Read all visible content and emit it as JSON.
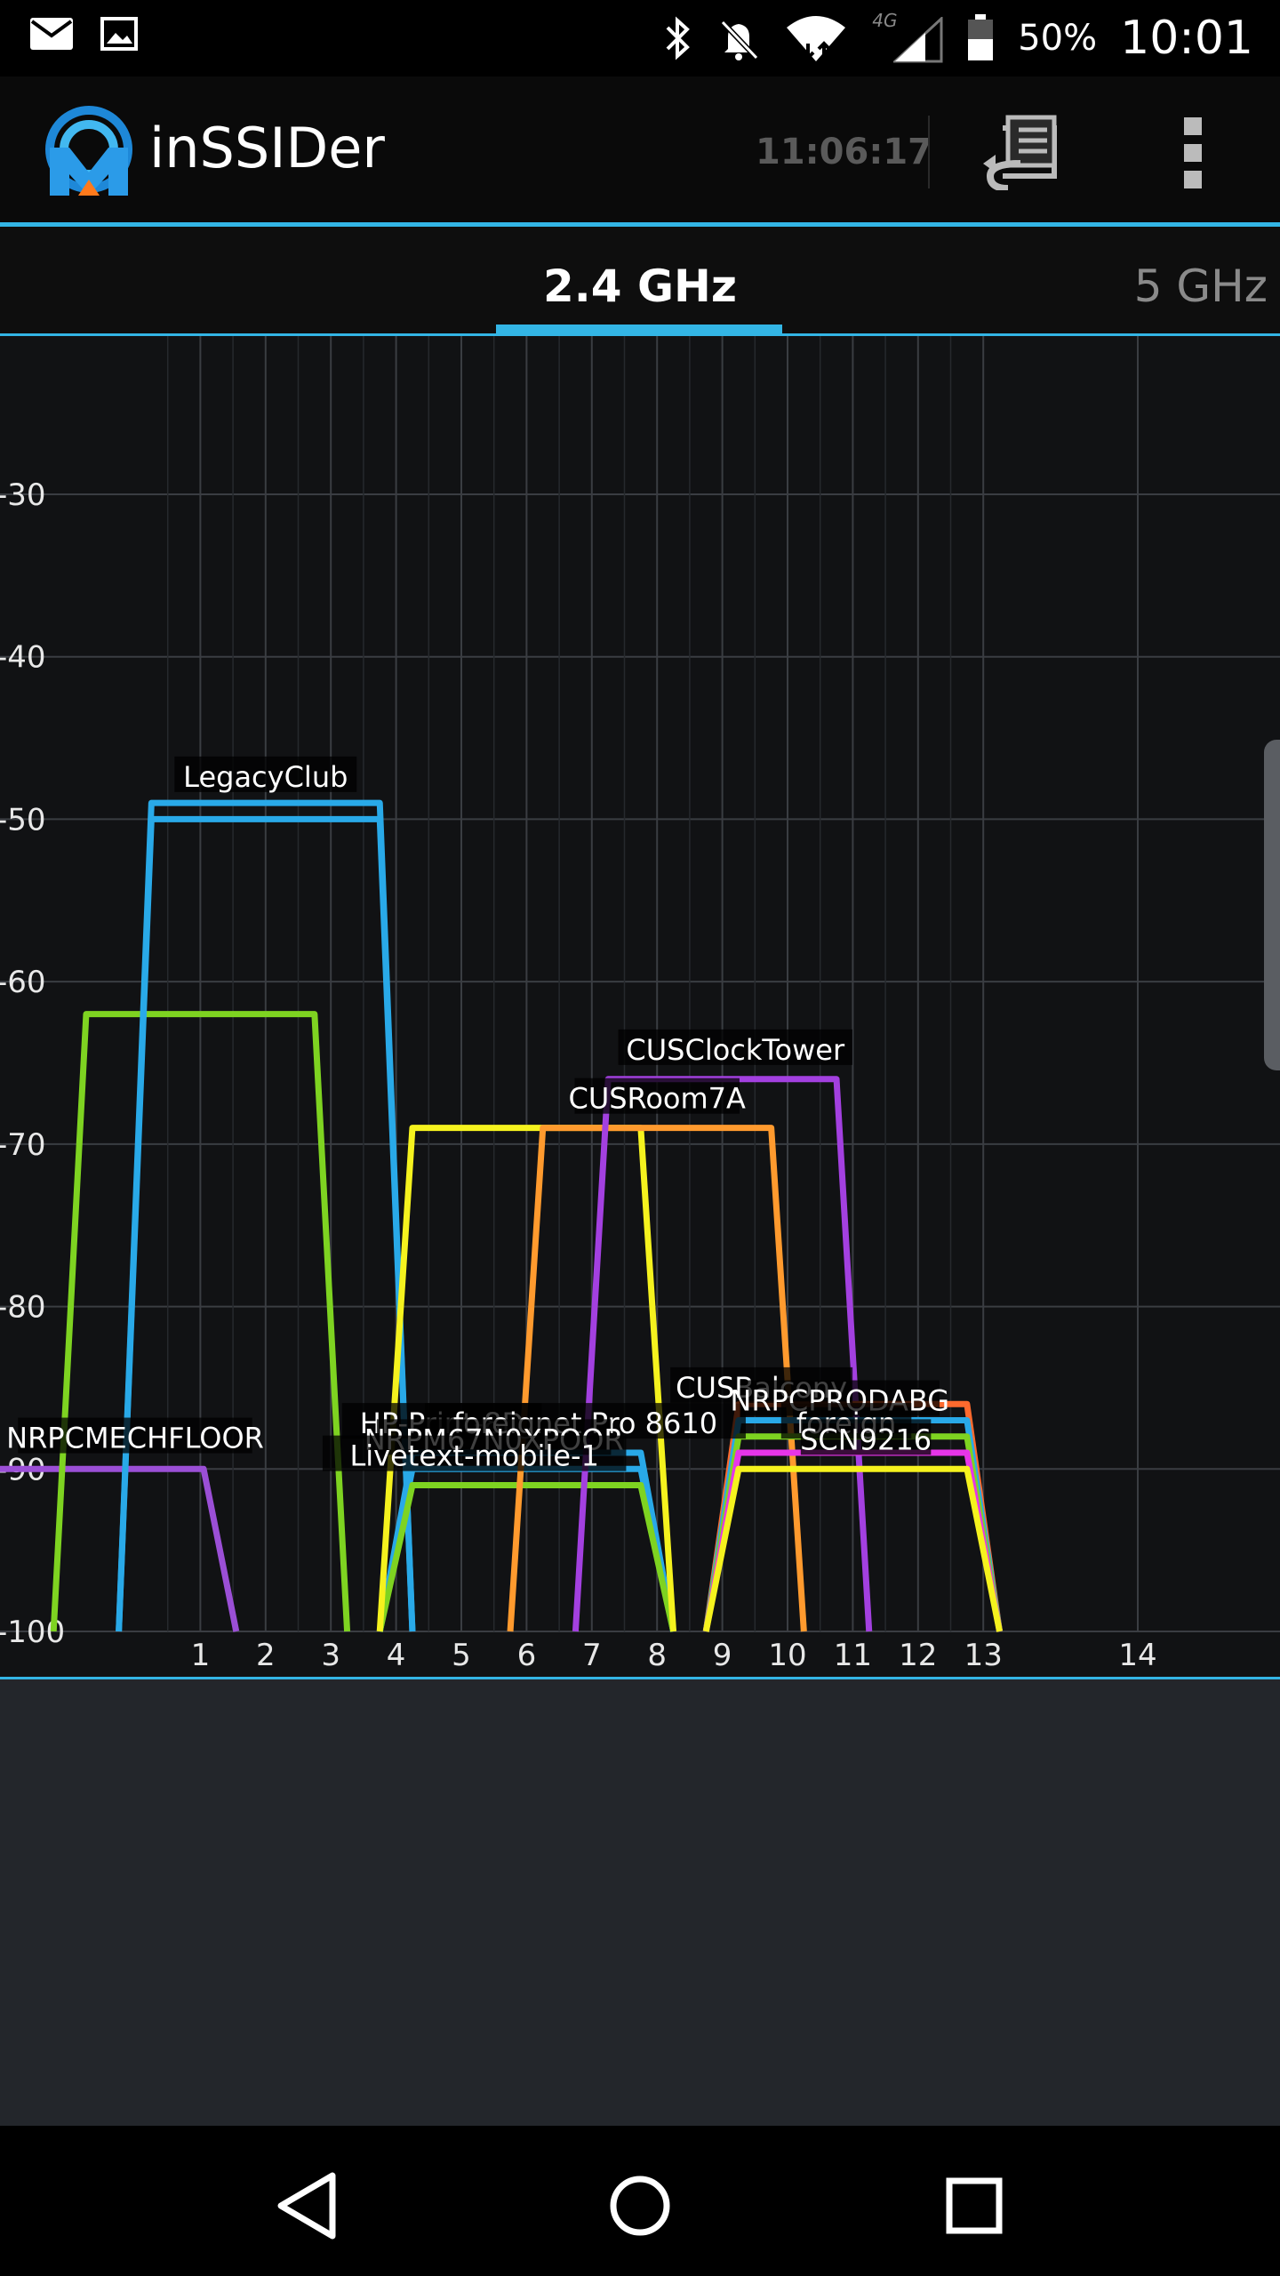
{
  "status_bar": {
    "icons": [
      "mail-icon",
      "gallery-icon",
      "bluetooth-icon",
      "mute-icon",
      "wifi-icon",
      "4g-lte-icon",
      "signal-icon",
      "battery-icon"
    ],
    "network_type": "4G",
    "battery": "50%",
    "time": "10:01"
  },
  "app_bar": {
    "title": "inSSIDer",
    "clock": "11:06:17",
    "logo_icon": "inssider-logo-icon",
    "actions": [
      "export-icon",
      "overflow-menu-icon"
    ]
  },
  "tabs": [
    {
      "label": "2.4 GHz",
      "selected": true
    },
    {
      "label": "5 GHz",
      "selected": false
    }
  ],
  "colors": {
    "accent": "#33b5e5",
    "grid": "#3a3d42",
    "chart_bg": "#111214"
  },
  "chart_data": {
    "type": "area",
    "x_ticks": [
      "1",
      "2",
      "3",
      "4",
      "5",
      "6",
      "7",
      "8",
      "9",
      "10",
      "11",
      "12",
      "13",
      "14"
    ],
    "y_ticks": [
      "-30",
      "-40",
      "-50",
      "-60",
      "-70",
      "-80",
      "-90",
      "-100"
    ],
    "ylim": [
      -100,
      -20
    ],
    "grid": true,
    "series": [
      {
        "name": "NRPCMECHFLOOR",
        "color": "#9b4fd6",
        "center": -0.7,
        "level": -90
      },
      {
        "name": "",
        "color": "#7ed321",
        "center": 1,
        "level": -62
      },
      {
        "name": "LegacyClub",
        "color": "#29a9e8",
        "center": 2,
        "level": -49
      },
      {
        "name": "LegacyClub",
        "color": "#29a9e8",
        "center": 2,
        "level": -50
      },
      {
        "name": "HP-Print-8D",
        "color": "#29a9e8",
        "center": 6,
        "level": -89
      },
      {
        "name": "NRPM67N0XPOOR",
        "color": "#29a9e8",
        "center": 6,
        "level": -90
      },
      {
        "name": "Livetext-mobile-1",
        "color": "#7ed321",
        "center": 6,
        "level": -91
      },
      {
        "name": "",
        "color": "#f5f21e",
        "center": 6,
        "level": -69
      },
      {
        "name": "CUSRoom7A",
        "color": "#ff9a2e",
        "center": 8,
        "level": -69
      },
      {
        "name": "CUSClockTower",
        "color": "#a340e0",
        "center": 9,
        "level": -66
      },
      {
        "name": "CUSBalcony",
        "color": "#ff6a2e",
        "center": 11,
        "level": -86
      },
      {
        "name": "NRPCPRODABG",
        "color": "#29a9e8",
        "center": 11,
        "level": -87
      },
      {
        "name": "",
        "color": "#7ed321",
        "center": 11,
        "level": -88
      },
      {
        "name": "",
        "color": "#e635e8",
        "center": 11,
        "level": -89
      },
      {
        "name": "",
        "color": "#f5f21e",
        "center": 11,
        "level": -90
      }
    ],
    "labels": [
      {
        "text": "LegacyClub",
        "x": 2,
        "y": -48
      },
      {
        "text": "CUSClockTower",
        "x": 9.2,
        "y": -64.8
      },
      {
        "text": "CUSRoom7A",
        "x": 8,
        "y": -67.8
      },
      {
        "text": "NRPCMECHFLOOR",
        "x": 0,
        "y": -88.7
      },
      {
        "text": "HP-Print-8D",
        "x": 4.7,
        "y": -87.8
      },
      {
        "text": "foreignet Pro 8610",
        "x": 6.9,
        "y": -87.8
      },
      {
        "text": "NRPM67N0XPOOR",
        "x": 5.5,
        "y": -88.8
      },
      {
        "text": "Livetext-mobile-1",
        "x": 5.2,
        "y": -89.8
      },
      {
        "text": "CUSBalcony",
        "x": 9.6,
        "y": -85.6
      },
      {
        "text": "NRPCPRODABG",
        "x": 10.8,
        "y": -86.4
      },
      {
        "text": "foreign",
        "x": 10.9,
        "y": -87.8
      },
      {
        "text": "SCN9216",
        "x": 11.2,
        "y": -88.8
      }
    ]
  },
  "nav_bar": {
    "buttons": [
      "back-icon",
      "home-icon",
      "recents-icon"
    ]
  }
}
